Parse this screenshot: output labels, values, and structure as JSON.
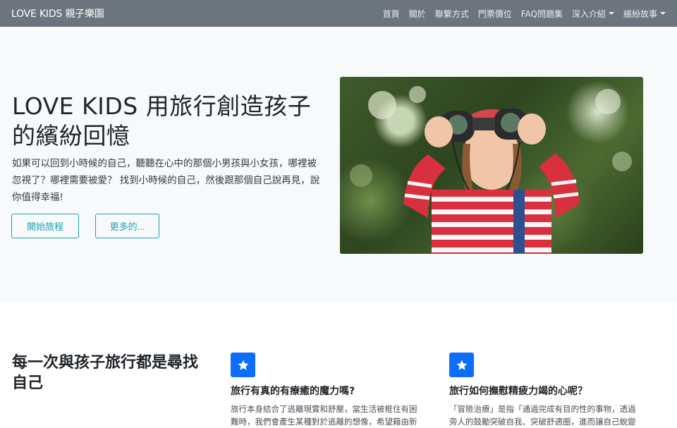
{
  "navbar": {
    "brand": "LOVE KIDS 親子樂園",
    "links": [
      "首頁",
      "關於",
      "聯繫方式",
      "門票價位",
      "FAQ問題集"
    ],
    "dropdowns": [
      "深入介紹",
      "繽紛故事"
    ]
  },
  "hero": {
    "title": "LOVE KIDS 用旅行創造孩子的繽紛回憶",
    "lead": "如果可以回到小時候的自己，聽聽在心中的那個小男孩與小女孩，哪裡被忽視了？哪裡需要被愛？ 找到小時候的自己，然後跟那個自己說再見，說你值得幸福!",
    "btn_start": "開始旅程",
    "btn_more": "更多的..."
  },
  "features": {
    "section_title": "每一次與孩子旅行都是尋找自己",
    "items": [
      {
        "title": "旅行有真的有療癒的魔力嗎?",
        "text": "旅行本身結合了逃離現實和舒壓，當生活被框住有困難時，我們會產生某種對於逃離的想像，希望藉由新"
      },
      {
        "title": "旅行如何撫慰精疲力竭的心呢？",
        "text": "「冒險治療」是指「通過完成有目的性的事物，透過旁人的鼓勵突破自我、突破舒適圈，進而讓自己蛻變"
      }
    ]
  },
  "colors": {
    "navbar": "#6c757d",
    "hero_bg": "#f8f9fa",
    "accent": "#17a2b8",
    "icon_bg": "#0d6efd"
  },
  "icons": {
    "feature": "star-icon",
    "caret": "caret-down-icon"
  }
}
